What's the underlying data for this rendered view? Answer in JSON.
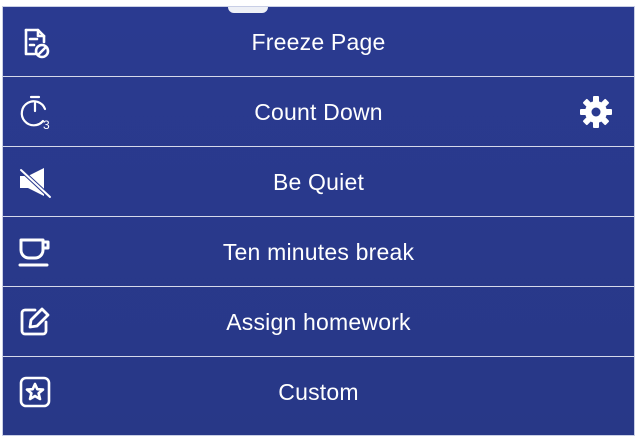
{
  "menu": {
    "items": [
      {
        "label": "Freeze Page",
        "icon": "freeze-page-icon"
      },
      {
        "label": "Count Down",
        "icon": "countdown-timer-icon",
        "badge": "3",
        "settings_icon": "gear-icon"
      },
      {
        "label": "Be Quiet",
        "icon": "mute-icon"
      },
      {
        "label": "Ten minutes break",
        "icon": "coffee-cup-icon"
      },
      {
        "label": "Assign homework",
        "icon": "edit-homework-icon"
      },
      {
        "label": "Custom",
        "icon": "star-box-icon"
      }
    ]
  },
  "colors": {
    "panel_background": "#2a3a90",
    "divider": "#d5d9ea",
    "text": "#ffffff"
  }
}
